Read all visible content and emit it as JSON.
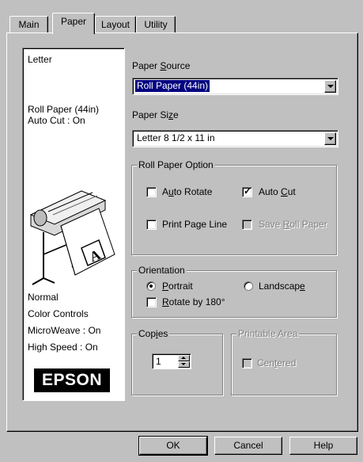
{
  "tabs": [
    {
      "label": "Main"
    },
    {
      "label": "Paper"
    },
    {
      "label": "Layout"
    },
    {
      "label": "Utility"
    }
  ],
  "preview": {
    "paper_type": "Letter",
    "roll_paper": "Roll Paper (44in)",
    "auto_cut": "Auto Cut : On",
    "mode": "Normal",
    "color_controls": "Color Controls",
    "microweave": "MicroWeave : On",
    "high_speed": "High Speed : On",
    "brand": "EPSON",
    "printer_icon": "large-format-printer-icon"
  },
  "paper_source": {
    "label_pre": "Paper ",
    "label_ul": "S",
    "label_post": "ource",
    "value": "Roll Paper (44in)"
  },
  "paper_size": {
    "label_pre": "Paper Si",
    "label_ul": "z",
    "label_post": "e",
    "value": "Letter 8 1/2 x 11 in"
  },
  "roll_paper_option": {
    "title": "Roll Paper Option",
    "auto_rotate": {
      "pre": "A",
      "ul": "u",
      "post": "to Rotate",
      "checked": false
    },
    "auto_cut": {
      "pre": "Auto ",
      "ul": "C",
      "post": "ut",
      "checked": true
    },
    "print_page_line": {
      "pre": "Print Pa",
      "ul": "g",
      "post": "e Line",
      "checked": false
    },
    "save_roll_paper": {
      "pre": "Save ",
      "ul": "R",
      "post": "oll Paper",
      "checked": false,
      "disabled": true
    }
  },
  "orientation": {
    "title": "Orientation",
    "portrait": {
      "ul": "P",
      "post": "ortrait",
      "selected": true
    },
    "landscape": {
      "pre": "Landscap",
      "ul": "e",
      "selected": false
    },
    "rotate": {
      "ul": "R",
      "post": "otate by 180°",
      "checked": false
    }
  },
  "copies": {
    "pre": "Cop",
    "ul": "i",
    "post": "es",
    "value": "1"
  },
  "printable_area": {
    "title": "Printable Area",
    "centered": {
      "pre": "Cen",
      "ul": "t",
      "post": "ered",
      "checked": false
    }
  },
  "buttons": {
    "ok": "OK",
    "cancel": "Cancel",
    "help": "Help"
  },
  "colors": {
    "face": "#c0c0c0",
    "highlight": "#000080"
  }
}
